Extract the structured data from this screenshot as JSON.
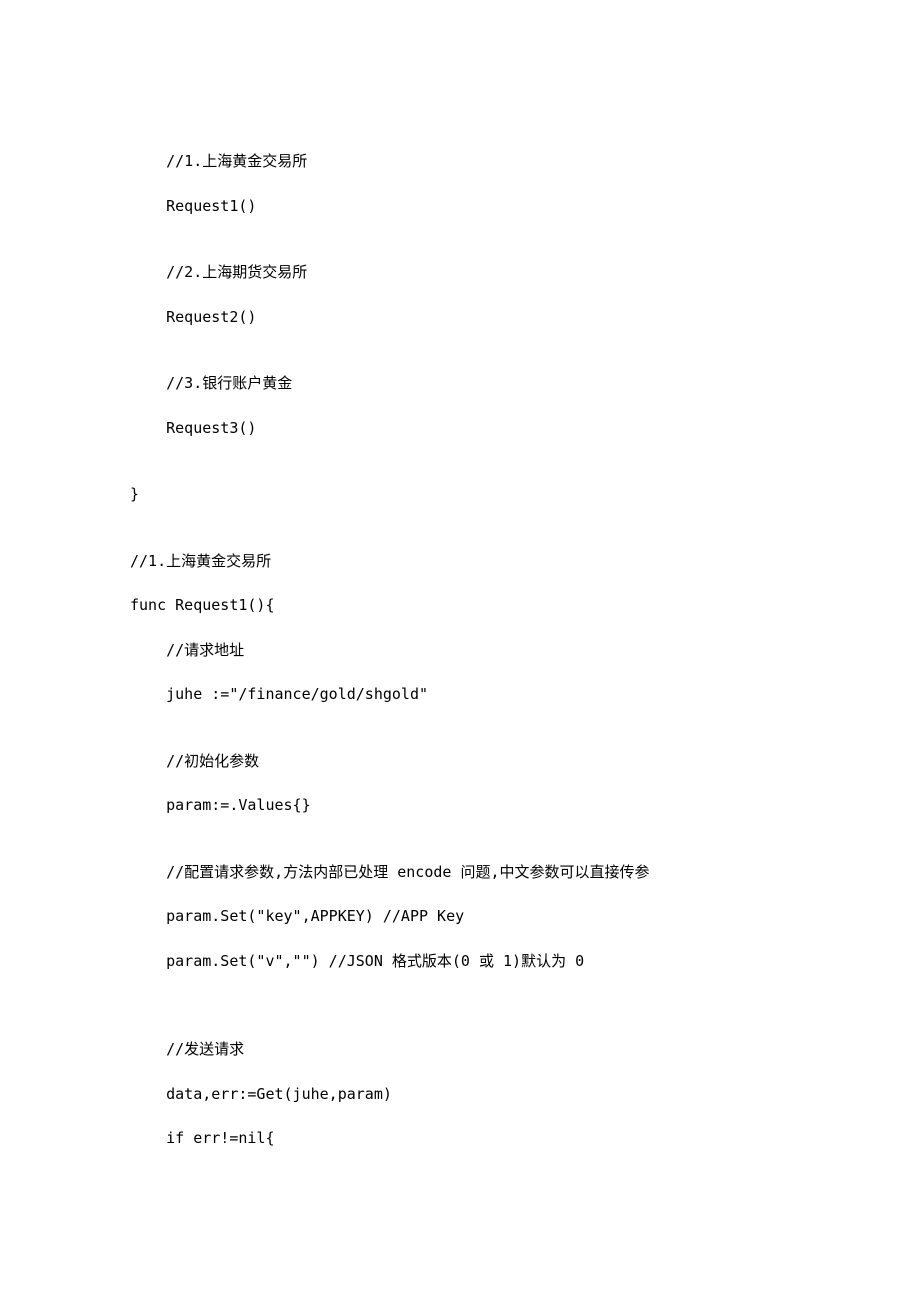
{
  "lines": {
    "l1": "    //1.上海黄金交易所",
    "l2": "    Request1()",
    "l3": "    //2.上海期货交易所",
    "l4": "    Request2()",
    "l5": "    //3.银行账户黄金",
    "l6": "    Request3()",
    "l7": "}",
    "l8": "//1.上海黄金交易所",
    "l9": "func Request1(){",
    "l10": "    //请求地址",
    "l11": "    juhe :=\"/finance/gold/shgold\"",
    "l12": "    //初始化参数",
    "l13": "    param:=.Values{}",
    "l14": "    //配置请求参数,方法内部已处理 encode 问题,中文参数可以直接传参",
    "l15": "    param.Set(\"key\",APPKEY) //APP Key",
    "l16": "    param.Set(\"v\",\"\") //JSON 格式版本(0 或 1)默认为 0",
    "l17": "    //发送请求",
    "l18": "    data,err:=Get(juhe,param)",
    "l19": "    if err!=nil{"
  }
}
